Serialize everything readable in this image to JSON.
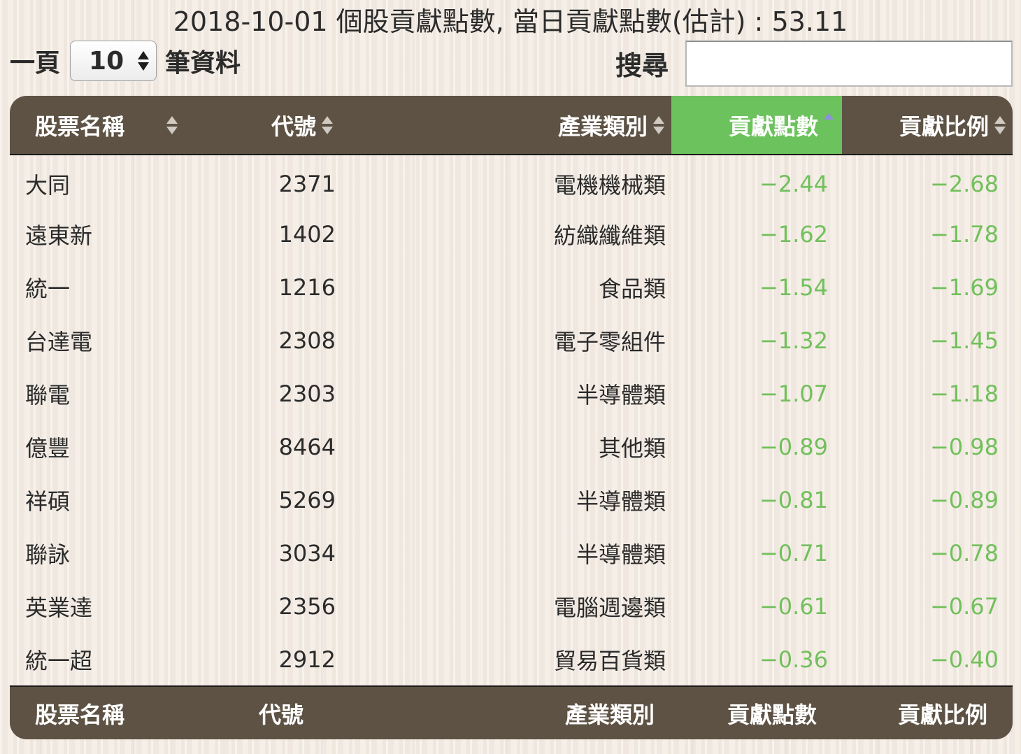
{
  "title": "2018-10-01 個股貢獻點數, 當日貢獻點數(估計) : 53.11",
  "length_control": {
    "prefix": "一頁",
    "selected": "10",
    "suffix": "筆資料"
  },
  "search": {
    "label": "搜尋",
    "value": ""
  },
  "table": {
    "columns": [
      "股票名稱",
      "代號",
      "產業類別",
      "貢獻點數",
      "貢獻比例"
    ],
    "sorted_column": "貢獻點數",
    "sort_direction": "ascending",
    "rows": [
      {
        "name": "大同",
        "code": "2371",
        "industry": "電機機械類",
        "points": "−2.44",
        "ratio": "−2.68"
      },
      {
        "name": "遠東新",
        "code": "1402",
        "industry": "紡織纖維類",
        "points": "−1.62",
        "ratio": "−1.78"
      },
      {
        "name": "統一",
        "code": "1216",
        "industry": "食品類",
        "points": "−1.54",
        "ratio": "−1.69"
      },
      {
        "name": "台達電",
        "code": "2308",
        "industry": "電子零組件",
        "points": "−1.32",
        "ratio": "−1.45"
      },
      {
        "name": "聯電",
        "code": "2303",
        "industry": "半導體類",
        "points": "−1.07",
        "ratio": "−1.18"
      },
      {
        "name": "億豐",
        "code": "8464",
        "industry": "其他類",
        "points": "−0.89",
        "ratio": "−0.98"
      },
      {
        "name": "祥碩",
        "code": "5269",
        "industry": "半導體類",
        "points": "−0.81",
        "ratio": "−0.89"
      },
      {
        "name": "聯詠",
        "code": "3034",
        "industry": "半導體類",
        "points": "−0.71",
        "ratio": "−0.78"
      },
      {
        "name": "英業達",
        "code": "2356",
        "industry": "電腦週邊類",
        "points": "−0.61",
        "ratio": "−0.67"
      },
      {
        "name": "統一超",
        "code": "2912",
        "industry": "貿易百貨類",
        "points": "−0.36",
        "ratio": "−0.40"
      }
    ]
  },
  "colors": {
    "header_bg": "#5d5244",
    "sorted_header_bg": "#6cc25c",
    "negative_value": "#72c05c"
  },
  "icons": {
    "select_arrows": "up-down-chevron-icon",
    "sort_both": "sort-both-icon",
    "sort_ascending": "sort-ascending-icon"
  }
}
